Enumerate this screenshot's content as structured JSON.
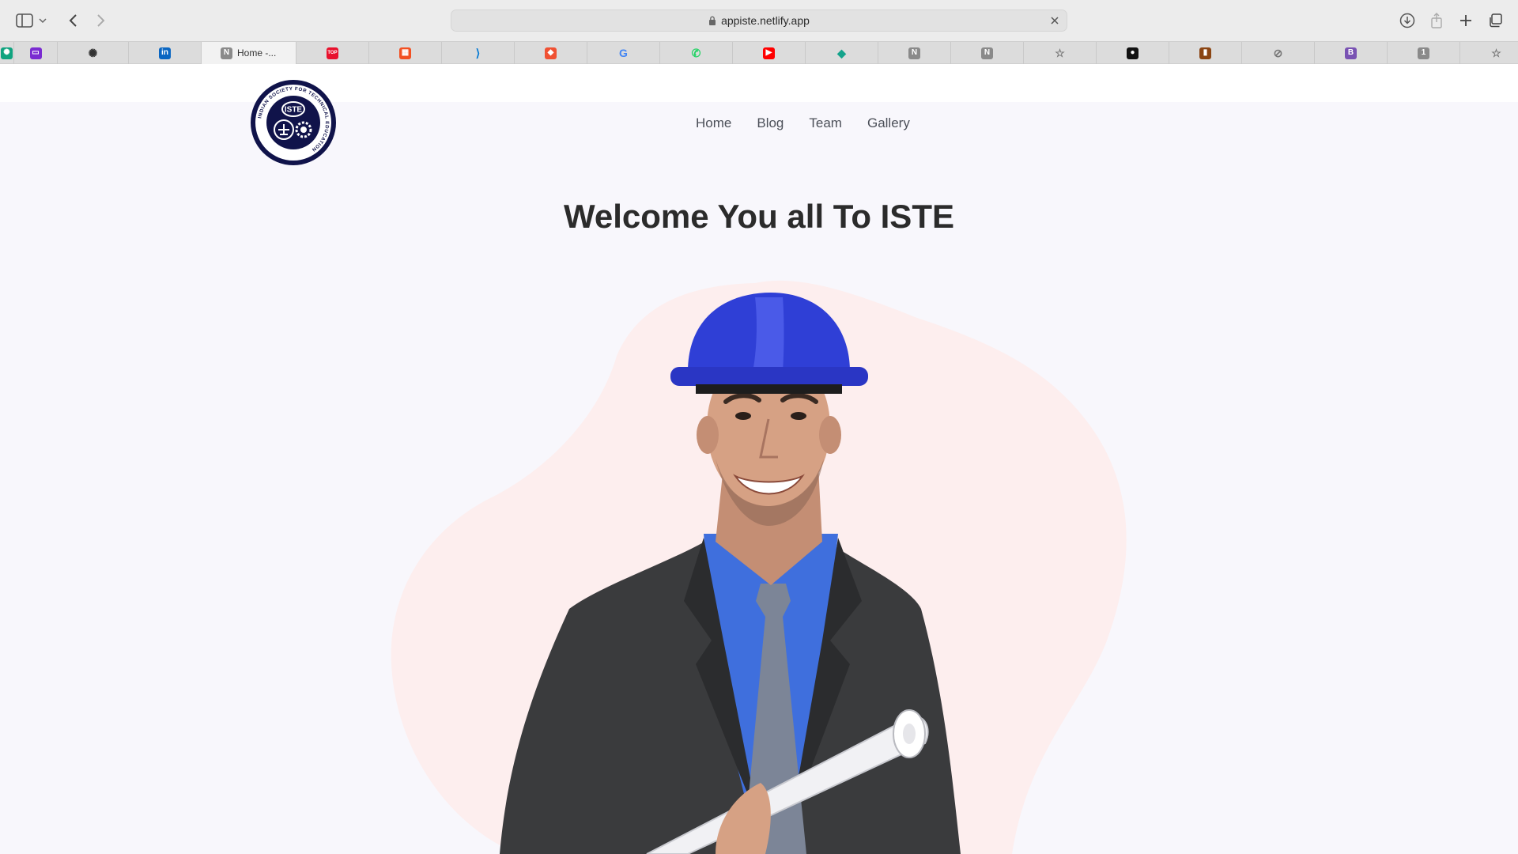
{
  "browser": {
    "url": "appiste.netlify.app",
    "tabs": [
      {
        "icon": "chatgpt-icon",
        "label": "",
        "color": "#10a37f"
      },
      {
        "icon": "presentation-icon",
        "label": "",
        "color": "#7a2bd1"
      },
      {
        "icon": "openai-icon",
        "label": "",
        "color": "#333333"
      },
      {
        "icon": "linkedin-icon",
        "label": "",
        "color": "#0a66c2"
      },
      {
        "icon": "notion-icon",
        "label": "Home -...",
        "color": "#8a8a8a"
      },
      {
        "icon": "top-icon",
        "label": "",
        "color": "#e8112d"
      },
      {
        "icon": "microsoft-icon",
        "label": "",
        "color": "#f25022"
      },
      {
        "icon": "vscode-icon",
        "label": "",
        "color": "#0078d4"
      },
      {
        "icon": "git-icon",
        "label": "",
        "color": "#f05133"
      },
      {
        "icon": "google-icon",
        "label": "",
        "color": "#4285f4"
      },
      {
        "icon": "whatsapp-icon",
        "label": "",
        "color": "#25d366"
      },
      {
        "icon": "youtube-icon",
        "label": "",
        "color": "#ff0000"
      },
      {
        "icon": "diamond-icon",
        "label": "",
        "color": "#14a38b"
      },
      {
        "icon": "notion-icon",
        "label": "",
        "color": "#8a8a8a"
      },
      {
        "icon": "notion-icon",
        "label": "",
        "color": "#8a8a8a"
      },
      {
        "icon": "star-icon",
        "label": "",
        "color": "#777777"
      },
      {
        "icon": "github-icon",
        "label": "",
        "color": "#111111"
      },
      {
        "icon": "book-icon",
        "label": "",
        "color": "#8b4513"
      },
      {
        "icon": "compass-icon",
        "label": "",
        "color": "#777777"
      },
      {
        "icon": "bootstrap-icon",
        "label": "",
        "color": "#7952b3"
      },
      {
        "icon": "one-icon",
        "label": "",
        "color": "#8a8a8a"
      },
      {
        "icon": "star-icon",
        "label": "",
        "color": "#777777"
      }
    ]
  },
  "site": {
    "logo": {
      "center_text": "ISTE",
      "ring_text": "INDIAN SOCIETY FOR TECHNICAL EDUCATION"
    },
    "nav": [
      "Home",
      "Blog",
      "Team",
      "Gallery"
    ],
    "hero_title": "Welcome You all To ISTE",
    "colors": {
      "logo_navy": "#10134a",
      "blob": "#fdeeee",
      "helmet": "#2f3fd6",
      "suit": "#3a3b3d",
      "shirt": "#3f6fdd"
    }
  }
}
